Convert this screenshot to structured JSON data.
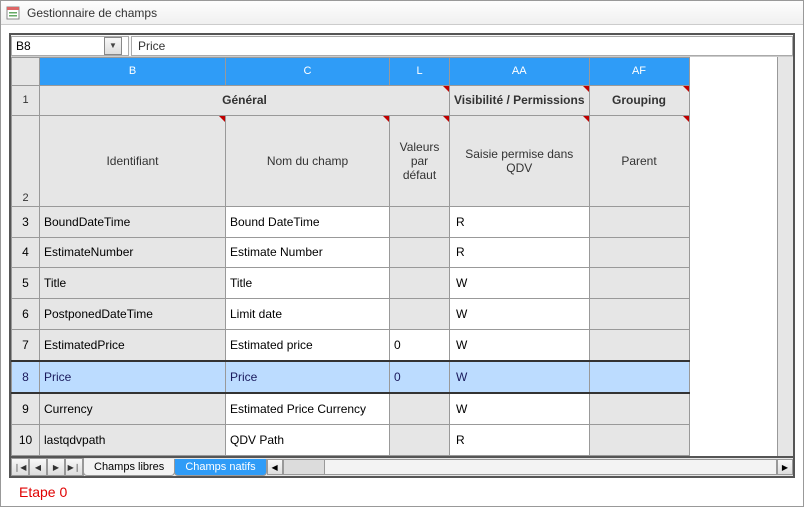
{
  "window": {
    "title": "Gestionnaire de champs"
  },
  "formula_bar": {
    "cell_ref": "B8",
    "value": "Price"
  },
  "columns": {
    "B": "B",
    "C": "C",
    "L": "L",
    "AA": "AA",
    "AF": "AF"
  },
  "group_headers": {
    "row1_num": "1",
    "general": "Général",
    "visibility": "Visibilité / Permissions",
    "grouping": "Grouping",
    "row2_num": "2",
    "identifiant": "Identifiant",
    "nom_champ": "Nom du champ",
    "valeurs_defaut": "Valeurs par défaut",
    "saisie_qdv": "Saisie permise dans QDV",
    "parent": "Parent"
  },
  "rows": [
    {
      "n": "3",
      "id": "BoundDateTime",
      "name": "Bound DateTime",
      "def": "",
      "perm": "R",
      "parent": "",
      "readonly": true
    },
    {
      "n": "4",
      "id": "EstimateNumber",
      "name": "Estimate Number",
      "def": "",
      "perm": "R",
      "parent": "",
      "readonly": true
    },
    {
      "n": "5",
      "id": "Title",
      "name": "Title",
      "def": "",
      "perm": "W",
      "parent": "",
      "readonly": false
    },
    {
      "n": "6",
      "id": "PostponedDateTime",
      "name": "Limit date",
      "def": "",
      "perm": "W",
      "parent": "",
      "readonly": false
    },
    {
      "n": "7",
      "id": "EstimatedPrice",
      "name": "Estimated price",
      "def": "0",
      "perm": "W",
      "parent": "",
      "readonly": false
    },
    {
      "n": "8",
      "id": "Price",
      "name": "Price",
      "def": "0",
      "perm": "W",
      "parent": "",
      "readonly": false,
      "selected": true
    },
    {
      "n": "9",
      "id": "Currency",
      "name": "Estimated Price Currency",
      "def": "",
      "perm": "W",
      "parent": "",
      "readonly": false
    },
    {
      "n": "10",
      "id": "lastqdvpath",
      "name": "QDV Path",
      "def": "",
      "perm": "R",
      "parent": "",
      "readonly": true
    }
  ],
  "tabs": {
    "free": "Champs libres",
    "native": "Champs natifs"
  },
  "caption": "Etape 0"
}
